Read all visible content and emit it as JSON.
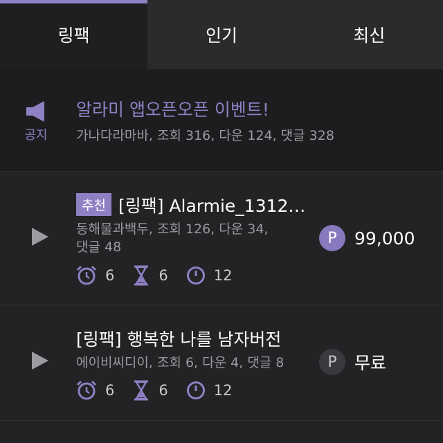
{
  "tabs": [
    {
      "label": "링팩"
    },
    {
      "label": "인기"
    },
    {
      "label": "최신"
    }
  ],
  "notice": {
    "label": "공지",
    "title": "알라미 앱오픈오픈 이벤트!",
    "meta": "가나다라마바, 조회 316, 다운 124, 댓글 328"
  },
  "items": [
    {
      "badge": "추천",
      "title": "[링팩] Alarmie_1312…",
      "meta_line1": "동해물과백두, 조회 126, 다운 34,",
      "meta_line2": "댓글 48",
      "alarm_count": "6",
      "timer_count": "6",
      "clock_count": "12",
      "price": "99,000",
      "price_icon": "P"
    },
    {
      "title": "[링팩] 행복한 나를 남자버전",
      "meta": "에이비씨디이, 조회 6, 다운 4, 댓글 8",
      "alarm_count": "6",
      "timer_count": "6",
      "clock_count": "12",
      "price": "무료",
      "price_icon": "P"
    }
  ],
  "colors": {
    "accent": "#8f80c4",
    "background": "#232325",
    "notice_background": "#1d1d1f",
    "muted_text": "#9a9a9e"
  },
  "icons": [
    "megaphone-icon",
    "play-icon",
    "alarm-clock-icon",
    "hourglass-icon",
    "clock-icon",
    "point-icon"
  ]
}
